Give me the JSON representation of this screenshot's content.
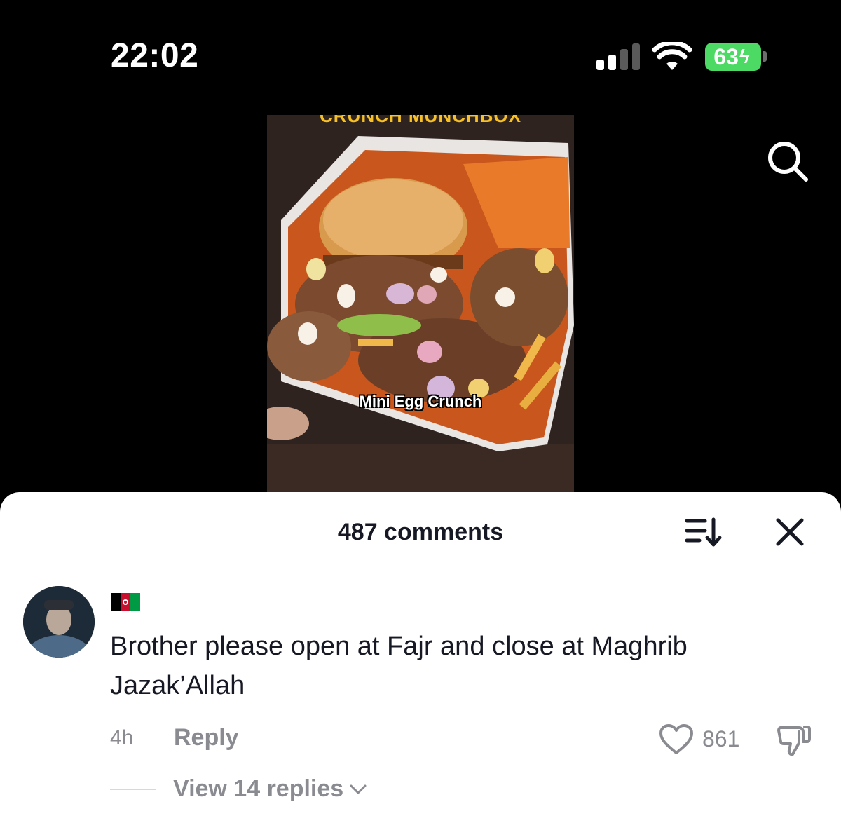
{
  "status_bar": {
    "time": "22:02",
    "battery": "63",
    "signal_strength_bars": 2,
    "colors": {
      "battery": "#4cd964"
    }
  },
  "header": {
    "search_icon": "search-icon"
  },
  "video": {
    "title": "CRUNCH MUNCHBOX",
    "caption": "Mini Egg Crunch"
  },
  "comments": {
    "count_label": "487 comments",
    "sort_icon": "sort-icon",
    "close_icon": "close-icon",
    "items": [
      {
        "avatar": "avatar",
        "username_flag": "afghanistan-flag",
        "text": "Brother please open at Fajr and close at Maghrib Jazak’Allah",
        "time": "4h",
        "reply_label": "Reply",
        "likes": "861",
        "view_replies_label": "View 14 replies"
      }
    ]
  }
}
